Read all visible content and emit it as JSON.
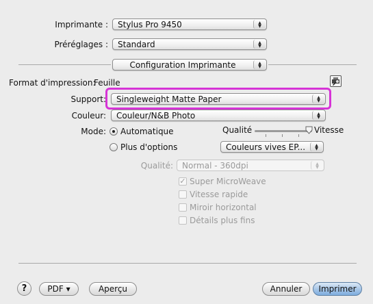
{
  "printer": {
    "label": "Imprimante :",
    "value": "Stylus Pro 9450"
  },
  "presets": {
    "label": "Préréglages :",
    "value": "Standard"
  },
  "panel": {
    "value": "Configuration Imprimante"
  },
  "format": {
    "label": "Format d'impression:",
    "value": "Feuille",
    "icon": "printer-utility-icon"
  },
  "support": {
    "label": "Support:",
    "value": "Singleweight Matte Paper"
  },
  "color": {
    "label": "Couleur:",
    "value": "Couleur/N&B Photo"
  },
  "mode": {
    "label": "Mode:",
    "automatic": "Automatique",
    "more_options": "Plus d'options",
    "selected": "Automatique"
  },
  "quality_slider": {
    "left_label": "Qualité",
    "right_label": "Vitesse",
    "level": 1.0
  },
  "color_mode": {
    "value": "Couleurs vives EP..."
  },
  "quality_disabled": {
    "label": "Qualité:",
    "value": "Normal - 360dpi"
  },
  "options": [
    {
      "label": "Super MicroWeave",
      "checked": true
    },
    {
      "label": "Vitesse rapide",
      "checked": false
    },
    {
      "label": "Miroir horizontal",
      "checked": false
    },
    {
      "label": "Détails plus fins",
      "checked": false
    }
  ],
  "footer": {
    "help": "?",
    "pdf": "PDF ▾",
    "preview": "Aperçu",
    "cancel": "Annuler",
    "print": "Imprimer"
  },
  "colors": {
    "highlight": "#d633d6",
    "default_button": "#7eaddf"
  }
}
